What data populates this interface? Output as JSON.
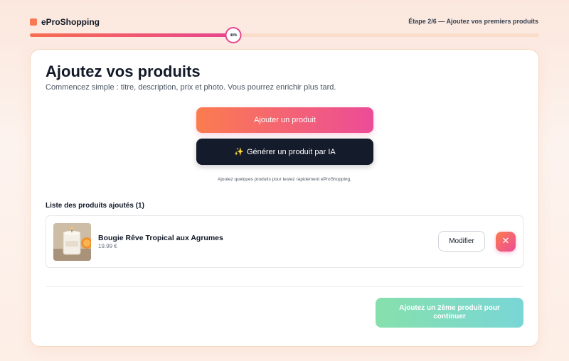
{
  "brand": {
    "name": "eProShopping",
    "mark_color": "#f97a52"
  },
  "progress": {
    "step_label": "Étape 2/6 — Ajoutez vos premiers produits",
    "percent": 40,
    "percent_label": "40%"
  },
  "main": {
    "title": "Ajoutez vos produits",
    "subtitle": "Commencez simple : titre, description, prix et photo. Vous pourrez enrichir plus tard.",
    "add_button": "Ajouter un produit",
    "ai_button_icon": "sparkles-icon",
    "ai_button_spark": "✨",
    "ai_button": "Générer un produit par IA",
    "hint": "Ajoutez quelques produits pour testez rapidement eProShopping."
  },
  "products": {
    "heading": "Liste des produits ajoutés (1)",
    "items": [
      {
        "name": "Bougie Rêve Tropical aux Agrumes",
        "price": "19.99 €",
        "edit_label": "Modifier",
        "delete_icon": "close-icon",
        "delete_glyph": "✕"
      }
    ]
  },
  "footer": {
    "continue_button": "Ajoutez un 2ème produit pour continuer"
  },
  "colors": {
    "accent_gradient_start": "#fb7c4f",
    "accent_gradient_end": "#ec4c98",
    "dark_button": "#141b2b",
    "continue_gradient_start": "#86e0ac",
    "continue_gradient_end": "#79d6d6"
  }
}
